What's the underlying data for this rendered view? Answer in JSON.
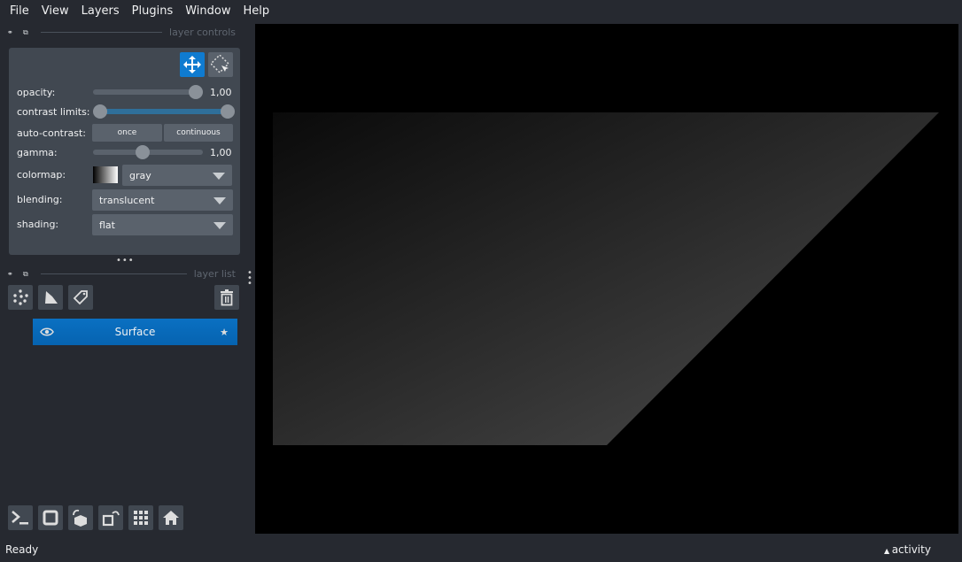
{
  "menu": [
    "File",
    "View",
    "Layers",
    "Plugins",
    "Window",
    "Help"
  ],
  "layer_controls": {
    "title": "layer controls",
    "opacity_label": "opacity:",
    "opacity_value": "1,00",
    "opacity": 1.0,
    "contrast_label": "contrast limits:",
    "contrast_range": [
      0,
      1
    ],
    "auto_contrast_label": "auto-contrast:",
    "once": "once",
    "continuous": "continuous",
    "gamma_label": "gamma:",
    "gamma_value": "1,00",
    "gamma_fraction": 0.45,
    "colormap_label": "colormap:",
    "colormap": "gray",
    "blending_label": "blending:",
    "blending": "translucent",
    "shading_label": "shading:",
    "shading": "flat"
  },
  "layer_list": {
    "title": "layer list",
    "layers": [
      {
        "name": "Surface",
        "selected": true,
        "visible": true
      }
    ]
  },
  "status": {
    "text": "Ready",
    "activity": "activity"
  },
  "colors": {
    "accent": "#0f7bd0",
    "panel": "#414851",
    "bg": "#262930",
    "button": "#5a626c"
  }
}
